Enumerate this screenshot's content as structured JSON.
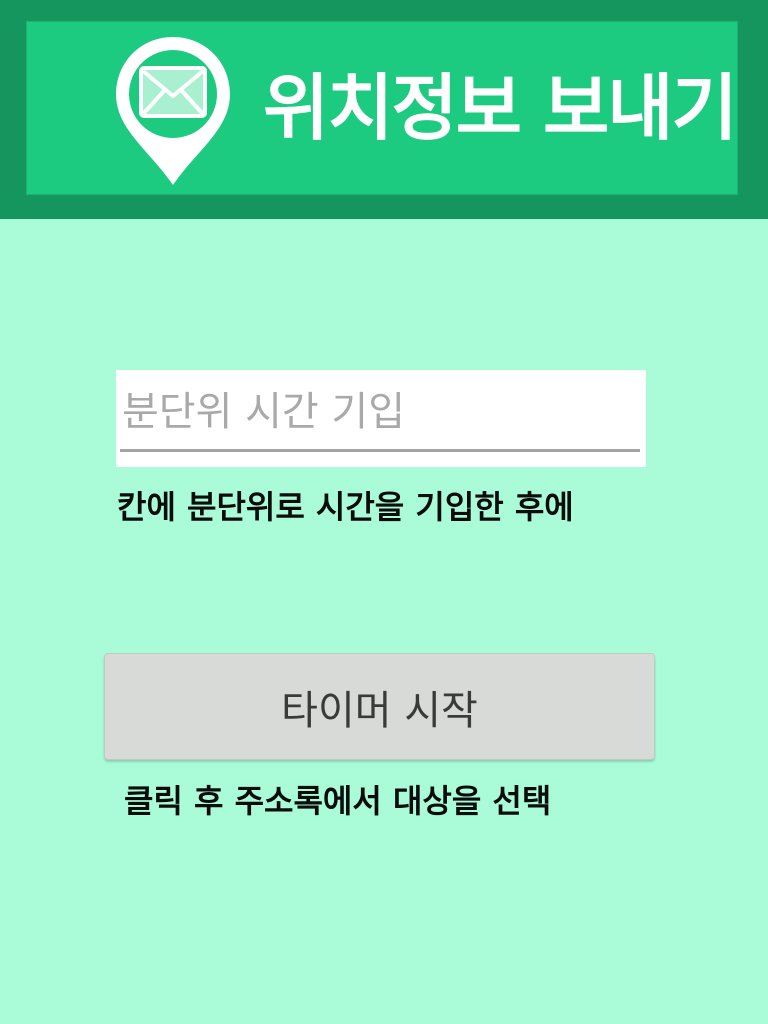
{
  "header": {
    "title": "위치정보 보내기",
    "icon": "mail-location-pin-icon",
    "colors": {
      "outer": "#16965f",
      "banner": "#1cca80"
    }
  },
  "minutes_input": {
    "value": "",
    "placeholder": "분단위 시간 기입"
  },
  "instruction_1": "칸에 분단위로 시간을 기입한 후에",
  "start_button": {
    "label": "타이머 시작"
  },
  "instruction_2": "클릭 후 주소록에서 대상을 선택",
  "background_color": "#aafcd8"
}
